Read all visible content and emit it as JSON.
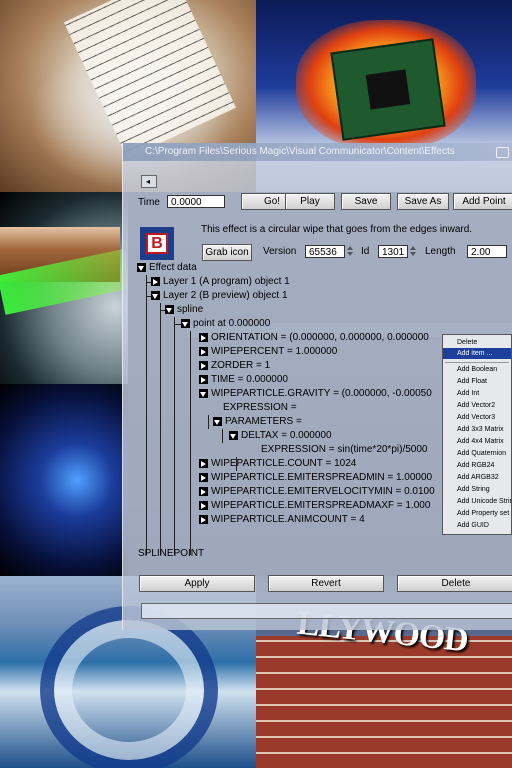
{
  "window": {
    "title": "C:\\Program Files\\Serious Magic\\Visual Communicator\\Content\\Effects"
  },
  "toolbar": {
    "time_label": "Time",
    "time_value": "0.0000",
    "go_label": "Go!",
    "play_label": "Play",
    "save_label": "Save",
    "save_as_label": "Save As",
    "add_point_label": "Add Point"
  },
  "effect": {
    "logo_letter": "B",
    "description": "This effect is a circular wipe that goes from the edges inward.",
    "grab_icon_label": "Grab icon",
    "version_label": "Version",
    "version_value": "65536",
    "id_label": "Id",
    "id_value": "1301",
    "length_label": "Length",
    "length_value": "2.00"
  },
  "tree": {
    "nodes": [
      "Effect data",
      "Layer 1 (A program) object 1",
      "Layer 2 (B preview) object 1",
      "spline",
      "point at 0.000000",
      "ORIENTATION = (0.000000, 0.000000, 0.000000",
      "WIPEPERCENT = 1.000000",
      "ZORDER = 1",
      "TIME = 0.000000",
      "WIPEPARTICLE.GRAVITY = (0.000000, -0.00050",
      "EXPRESSION =",
      "PARAMETERS =",
      "DELTAX = 0.000000",
      "EXPRESSION = sin(time*20*pi)/5000",
      "WIPEPARTICLE.COUNT = 1024",
      "WIPEPARTICLE.EMITERSPREADMIN = 1.00000",
      "WIPEPARTICLE.EMITERVELOCITYMIN = 0.0100",
      "WIPEPARTICLE.EMITERSPREADMAXF = 1.000",
      "WIPEPARTICLE.ANIMCOUNT = 4"
    ],
    "footer": "SPLINEPOINT"
  },
  "actions": {
    "apply_label": "Apply",
    "revert_label": "Revert",
    "delete_label": "Delete"
  },
  "context_menu": {
    "items": [
      "Delete",
      "Add item ...",
      "Add Boolean",
      "Add Float",
      "Add Int",
      "Add Vector2",
      "Add Vector3",
      "Add 3x3 Matrix",
      "Add 4x4 Matrix",
      "Add Quaternion",
      "Add RGB24",
      "Add ARGB32",
      "Add String",
      "Add Unicode String",
      "Add Property set",
      "Add GUID"
    ]
  },
  "background": {
    "sign_text": "LLYWOOD"
  },
  "colors": {
    "menu_highlight": "#1b3f9a",
    "logo_blue": "#1e3d8a",
    "logo_red": "#c0181e"
  }
}
